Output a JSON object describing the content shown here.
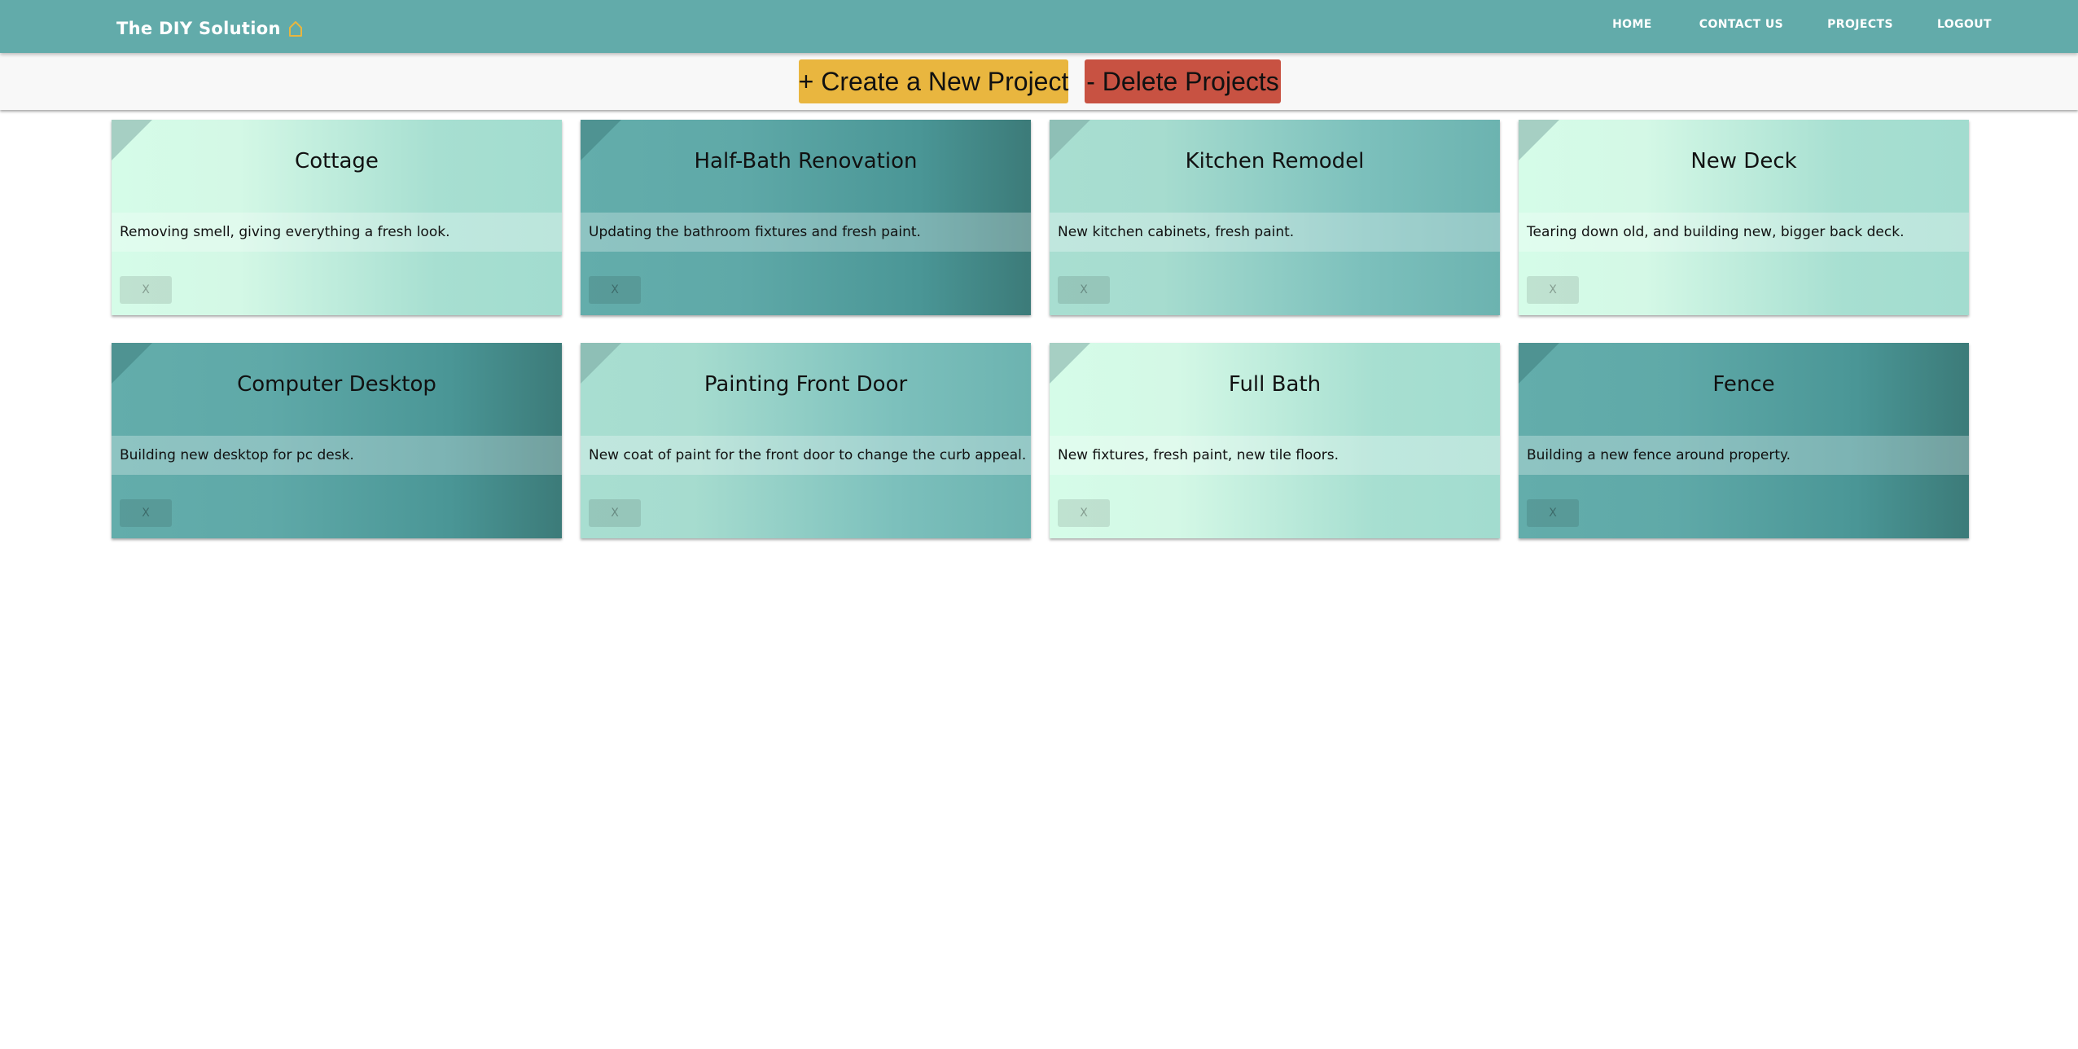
{
  "navbar": {
    "brand": "The DIY Solution",
    "brand_icon": "home-icon",
    "links": [
      "HOME",
      "CONTACT US",
      "PROJECTS",
      "LOGOUT"
    ]
  },
  "actions": {
    "create_label": "+ Create a New Project",
    "delete_label": "- Delete Projects"
  },
  "colors": {
    "nav_background": "#62abaa",
    "create_button": "#e9b63f",
    "delete_button": "#c85242",
    "brand_icon": "#e9b63f"
  },
  "projects": [
    {
      "title": "Cottage",
      "description": "Removing smell, giving everything a fresh look.",
      "close_label": "X",
      "theme": "light"
    },
    {
      "title": "Half-Bath Renovation",
      "description": "Updating the bathroom fixtures and fresh paint.",
      "close_label": "X",
      "theme": "dark"
    },
    {
      "title": "Kitchen Remodel",
      "description": "New kitchen cabinets, fresh paint.",
      "close_label": "X",
      "theme": "mid"
    },
    {
      "title": "New Deck",
      "description": "Tearing down old, and building new, bigger back deck.",
      "close_label": "X",
      "theme": "light"
    },
    {
      "title": "Computer Desktop",
      "description": "Building new desktop for pc desk.",
      "close_label": "X",
      "theme": "dark"
    },
    {
      "title": "Painting Front Door",
      "description": "New coat of paint for the front door to change the curb appeal.",
      "close_label": "X",
      "theme": "mid"
    },
    {
      "title": "Full Bath",
      "description": "New fixtures, fresh paint, new tile floors.",
      "close_label": "X",
      "theme": "light"
    },
    {
      "title": "Fence",
      "description": "Building a new fence around property.",
      "close_label": "X",
      "theme": "dark"
    }
  ]
}
